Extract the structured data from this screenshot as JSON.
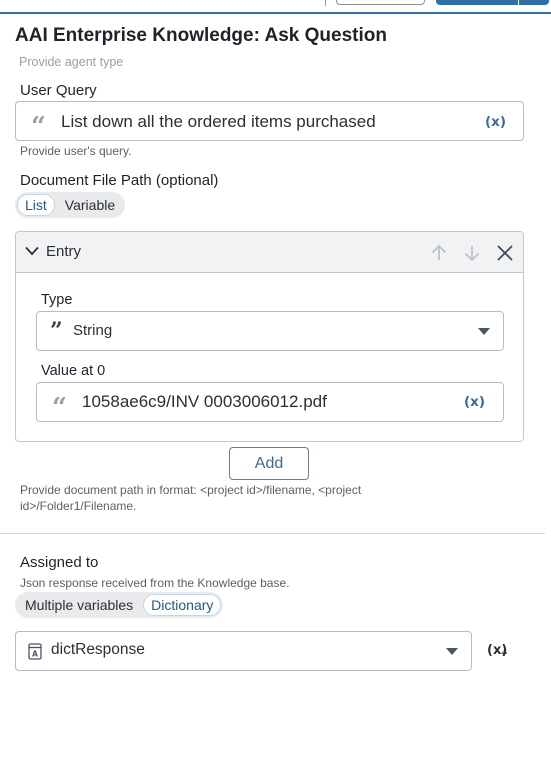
{
  "window": {
    "title": "AAI Enterprise Knowledge: Ask Question"
  },
  "agent_type": {
    "hint": "Provide agent type"
  },
  "user_query": {
    "label": "User Query",
    "value": "List down all the ordered items purchased",
    "var_button": "(x)",
    "hint": "Provide user's query."
  },
  "document_path": {
    "label": "Document File Path (optional)",
    "toggle": [
      "List",
      "Variable"
    ],
    "selected": "List",
    "entry": {
      "title": "Entry",
      "type_label": "Type",
      "type_value": "String",
      "value_label": "Value at 0",
      "value": "1058ae6c9/INV 0003006012.pdf",
      "var_button": "(x)"
    },
    "add_button": "Add",
    "hint": "Provide document path in format: <project id>/filename, <project id>/Folder1/Filename."
  },
  "assigned_to": {
    "label": "Assigned to",
    "hint": "Json response received from the Knowledge base.",
    "toggle": [
      "Multiple variables",
      "Dictionary"
    ],
    "selected": "Dictionary",
    "variable": "dictResponse",
    "var_button": "(x)"
  },
  "colors": {
    "accent": "#2f6fa6",
    "link": "#3b6b95",
    "border": "#b8bcc2"
  },
  "icons": {
    "quote": "quote-icon",
    "collapse": "chevron-down-icon",
    "up": "arrow-up-icon",
    "down": "arrow-down-icon",
    "close": "close-icon",
    "dropdown": "caret-down-icon",
    "dictionary": "dictionary-variable-icon",
    "add_variable": "add-variable-icon"
  }
}
